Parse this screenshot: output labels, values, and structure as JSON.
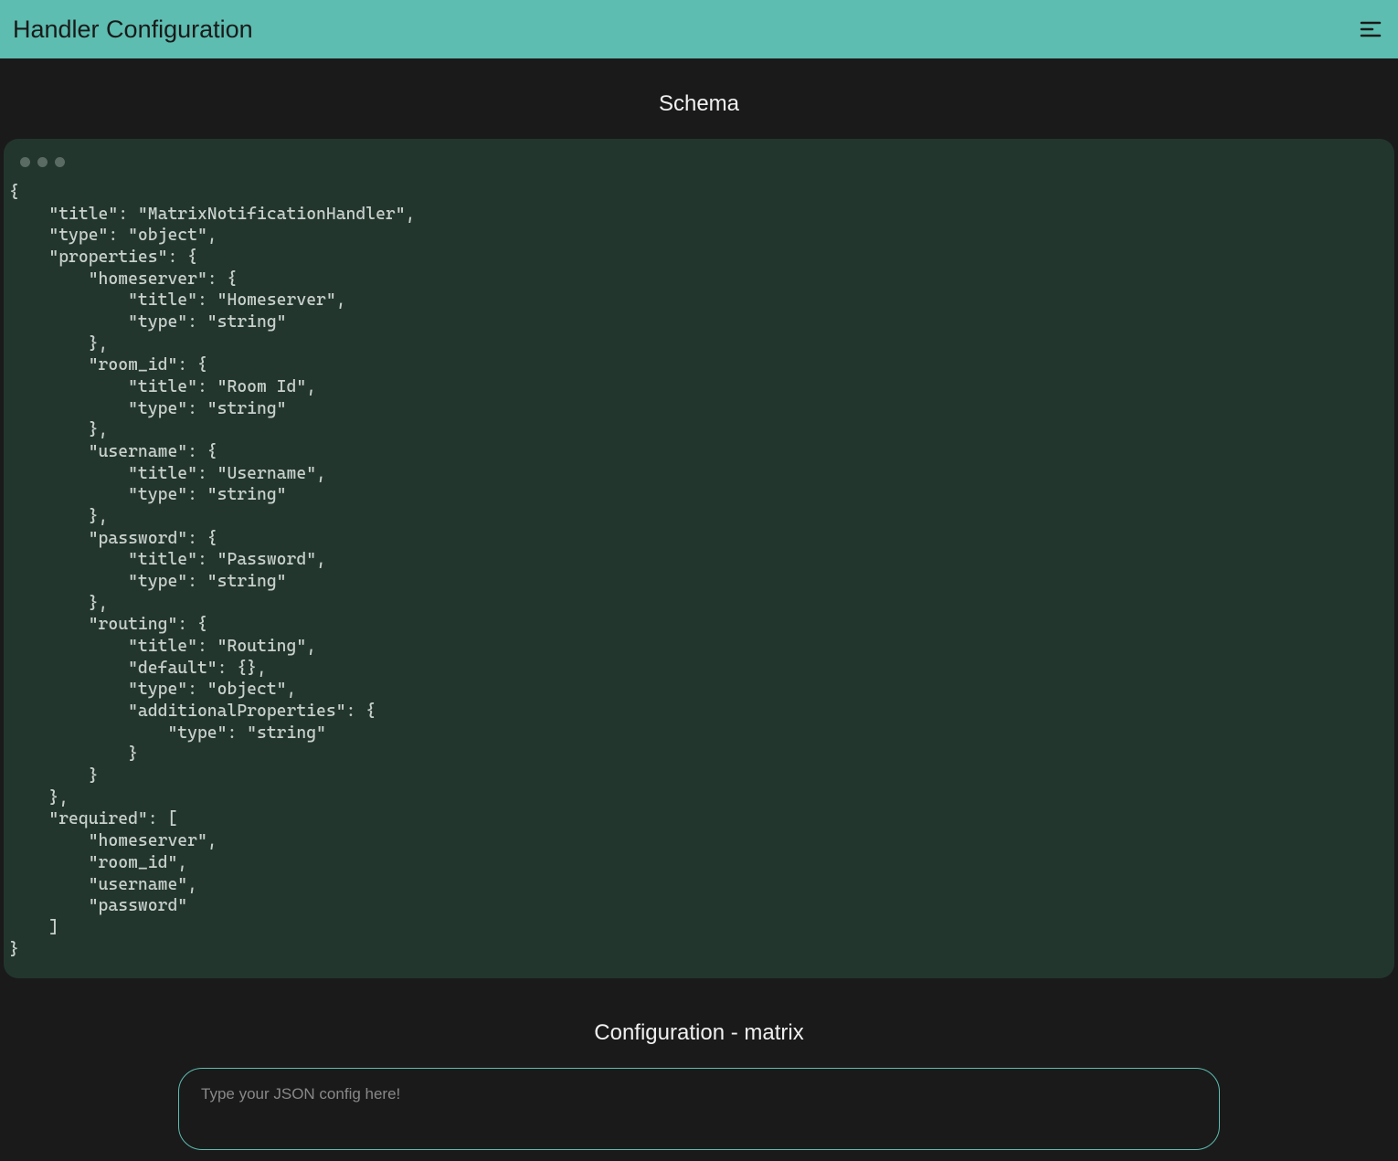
{
  "header": {
    "title": "Handler Configuration"
  },
  "schema": {
    "section_title": "Schema",
    "code": "{\n    \"title\": \"MatrixNotificationHandler\",\n    \"type\": \"object\",\n    \"properties\": {\n        \"homeserver\": {\n            \"title\": \"Homeserver\",\n            \"type\": \"string\"\n        },\n        \"room_id\": {\n            \"title\": \"Room Id\",\n            \"type\": \"string\"\n        },\n        \"username\": {\n            \"title\": \"Username\",\n            \"type\": \"string\"\n        },\n        \"password\": {\n            \"title\": \"Password\",\n            \"type\": \"string\"\n        },\n        \"routing\": {\n            \"title\": \"Routing\",\n            \"default\": {},\n            \"type\": \"object\",\n            \"additionalProperties\": {\n                \"type\": \"string\"\n            }\n        }\n    },\n    \"required\": [\n        \"homeserver\",\n        \"room_id\",\n        \"username\",\n        \"password\"\n    ]\n}"
  },
  "config": {
    "section_title": "Configuration - matrix",
    "textarea_placeholder": "Type your JSON config here!",
    "textarea_value": ""
  }
}
